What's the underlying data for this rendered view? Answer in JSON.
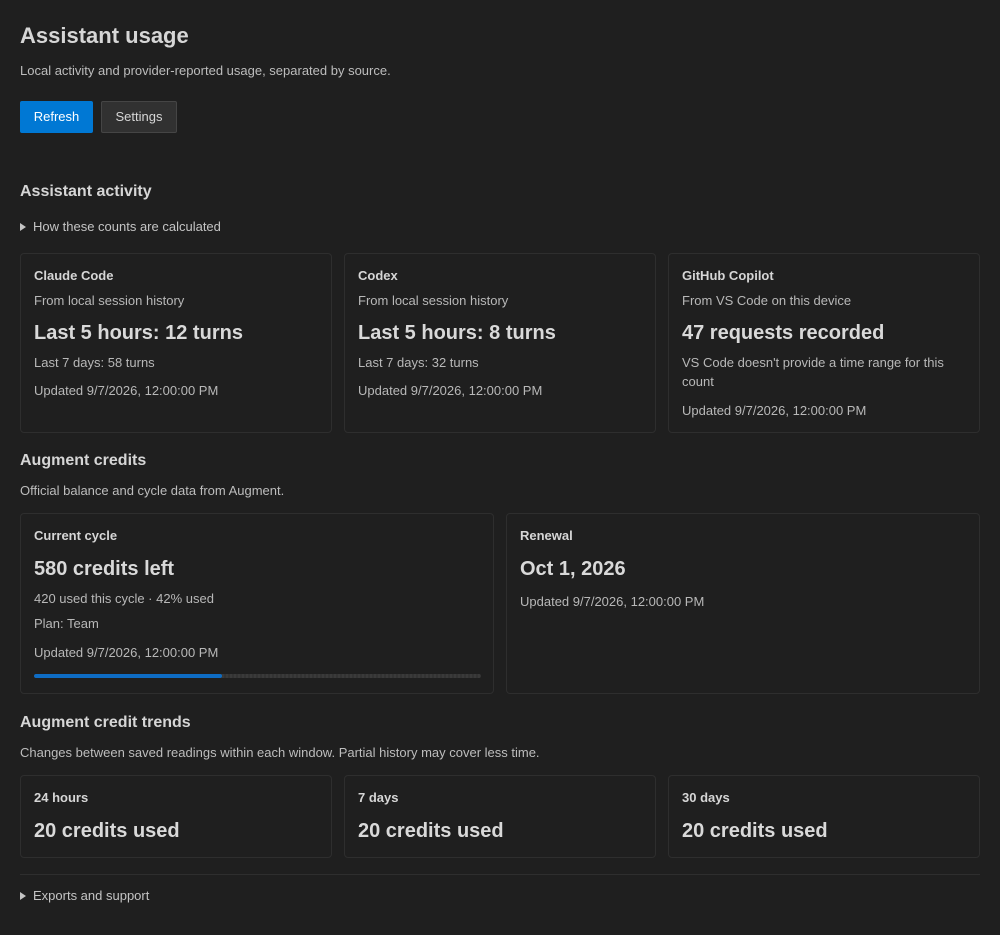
{
  "header": {
    "title": "Assistant usage",
    "subtitle": "Local activity and provider-reported usage, separated by source."
  },
  "toolbar": {
    "refresh_label": "Refresh",
    "settings_label": "Settings"
  },
  "activity": {
    "heading": "Assistant activity",
    "disclosure": "How these counts are calculated",
    "cards": [
      {
        "title": "Claude Code",
        "source": "From local session history",
        "big": "Last 5 hours: 12 turns",
        "detail": "Last 7 days: 58 turns",
        "updated": "Updated 9/7/2026, 12:00:00 PM"
      },
      {
        "title": "Codex",
        "source": "From local session history",
        "big": "Last 5 hours: 8 turns",
        "detail": "Last 7 days: 32 turns",
        "updated": "Updated 9/7/2026, 12:00:00 PM"
      },
      {
        "title": "GitHub Copilot",
        "source": "From VS Code on this device",
        "big": "47 requests recorded",
        "detail": "VS Code doesn't provide a time range for this count",
        "updated": "Updated 9/7/2026, 12:00:00 PM"
      }
    ]
  },
  "credits": {
    "heading": "Augment credits",
    "description": "Official balance and cycle data from Augment.",
    "current_cycle": {
      "title": "Current cycle",
      "big": "580 credits left",
      "usage": "420 used this cycle · 42% used",
      "plan": "Plan: Team",
      "updated": "Updated 9/7/2026, 12:00:00 PM",
      "progress_fraction": 0.42,
      "progress_color": "#0e6cc4"
    },
    "renewal": {
      "title": "Renewal",
      "big": "Oct 1, 2026",
      "updated": "Updated 9/7/2026, 12:00:00 PM"
    }
  },
  "trends": {
    "heading": "Augment credit trends",
    "description": "Changes between saved readings within each window. Partial history may cover less time.",
    "cards": [
      {
        "title": "24 hours",
        "big": "20 credits used"
      },
      {
        "title": "7 days",
        "big": "20 credits used"
      },
      {
        "title": "30 days",
        "big": "20 credits used"
      }
    ]
  },
  "footer": {
    "disclosure": "Exports and support"
  },
  "colors": {
    "background": "#1f1f1f",
    "primary_button": "#0078d4",
    "card_border": "#2e2e2e"
  }
}
